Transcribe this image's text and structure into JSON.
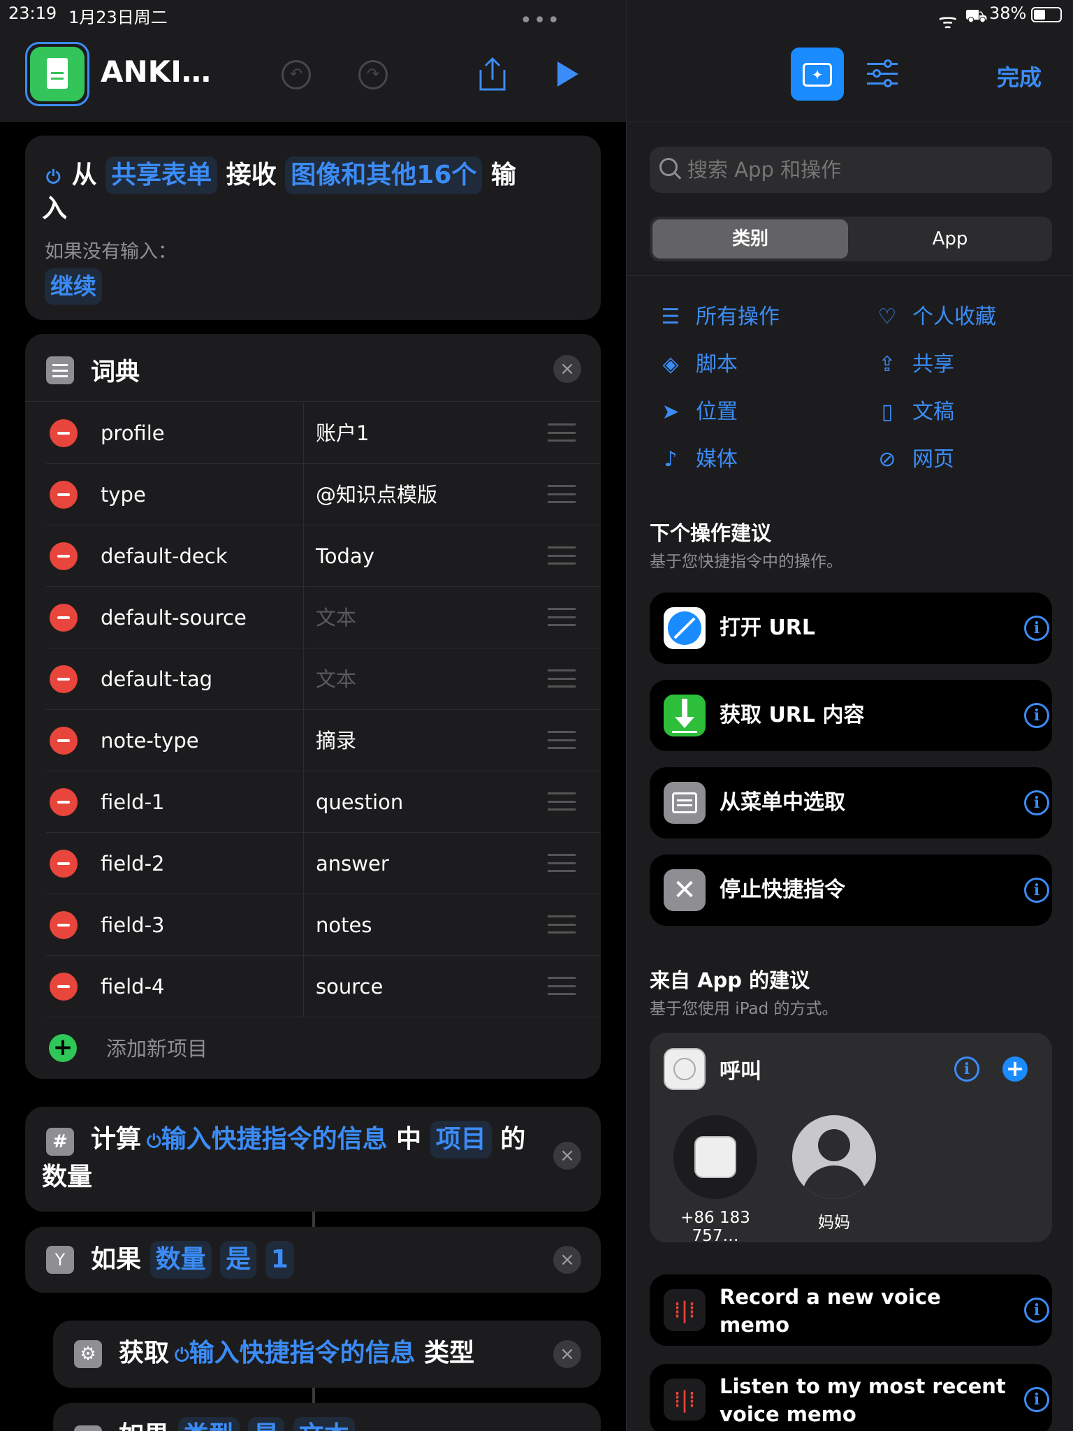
{
  "status": {
    "time": "23:19",
    "date": "1月23日周二",
    "battery": "38%"
  },
  "header": {
    "title": "ANKI…",
    "done": "完成"
  },
  "receive": {
    "from": "从",
    "source": "共享表单",
    "receive": "接收",
    "types": "图像和其他16个",
    "tail1": "输",
    "tail2": "入",
    "no_input_label": "如果没有输入：",
    "continue": "继续"
  },
  "dict": {
    "title": "词典",
    "add_item": "添加新项目",
    "rows": [
      {
        "key": "profile",
        "value": "账户1"
      },
      {
        "key": "type",
        "value": "@知识点模版"
      },
      {
        "key": "default-deck",
        "value": "Today"
      },
      {
        "key": "default-source",
        "value": "文本",
        "placeholder": true
      },
      {
        "key": "default-tag",
        "value": "文本",
        "placeholder": true
      },
      {
        "key": "note-type",
        "value": "摘录"
      },
      {
        "key": "field-1",
        "value": "question"
      },
      {
        "key": "field-2",
        "value": "answer"
      },
      {
        "key": "field-3",
        "value": "notes"
      },
      {
        "key": "field-4",
        "value": "source"
      }
    ]
  },
  "count": {
    "verb": "计算",
    "input": "输入快捷指令的信息",
    "mid": "中",
    "items": "项目",
    "of": "的",
    "tail": "数量"
  },
  "ifblock": {
    "verb": "如果",
    "var": "数量",
    "op": "是",
    "val": "1"
  },
  "getblock": {
    "verb": "获取",
    "input": "输入快捷指令的信息",
    "tail": "类型"
  },
  "ifblock2": {
    "verb": "如果",
    "var": "类型",
    "op": "是",
    "val": "文本"
  },
  "search": {
    "placeholder": "搜索 App 和操作"
  },
  "segments": {
    "cat": "类别",
    "app": "App"
  },
  "categories": [
    {
      "label": "所有操作",
      "icon": "list-icon",
      "glyph": "☰"
    },
    {
      "label": "个人收藏",
      "icon": "heart-icon",
      "glyph": "♡"
    },
    {
      "label": "脚本",
      "icon": "script-icon",
      "glyph": "◈"
    },
    {
      "label": "共享",
      "icon": "share-icon",
      "glyph": "⇪"
    },
    {
      "label": "位置",
      "icon": "location-icon",
      "glyph": "➤"
    },
    {
      "label": "文稿",
      "icon": "document-icon",
      "glyph": "▯"
    },
    {
      "label": "媒体",
      "icon": "music-icon",
      "glyph": "♪"
    },
    {
      "label": "网页",
      "icon": "compass-icon",
      "glyph": "⊘"
    }
  ],
  "next": {
    "title": "下个操作建议",
    "sub": "基于您快捷指令中的操作。",
    "items": [
      {
        "label": "打开 URL",
        "icon": "safari-icon"
      },
      {
        "label": "获取 URL 内容",
        "icon": "download-icon"
      },
      {
        "label": "从菜单中选取",
        "icon": "menu-icon"
      },
      {
        "label": "停止快捷指令",
        "icon": "stop-icon"
      }
    ]
  },
  "apps": {
    "title": "来自 App 的建议",
    "sub": "基于您使用 iPad 的方式。",
    "call": "呼叫",
    "contact1": "+86 183 757…",
    "contact2": "妈妈",
    "voice1a": "Record a new voice",
    "voice1b": "memo",
    "voice2a": "Listen to my most recent",
    "voice2b": "voice memo"
  },
  "colors": {
    "accent": "#3b8cf7",
    "danger": "#e8453c",
    "add": "#30c759",
    "doc_app": "#33c45a"
  }
}
